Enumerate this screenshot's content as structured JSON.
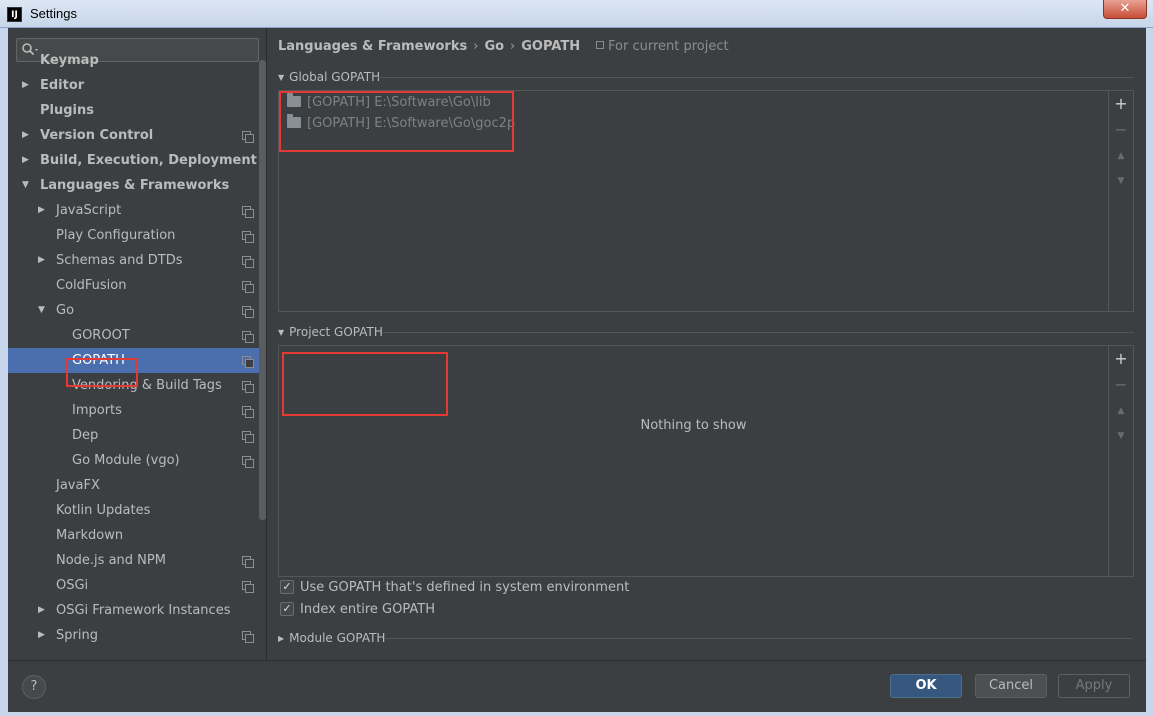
{
  "window": {
    "title": "Settings",
    "app_icon": "IJ",
    "close_glyph": "✕"
  },
  "sidebar": {
    "search_placeholder": "",
    "items": [
      {
        "label": "Keymap",
        "bold": true
      },
      {
        "label": "Editor",
        "bold": true
      },
      {
        "label": "Plugins",
        "bold": true
      },
      {
        "label": "Version Control",
        "bold": true
      },
      {
        "label": "Build, Execution, Deployment",
        "bold": true
      },
      {
        "label": "Languages & Frameworks",
        "bold": true
      },
      {
        "label": "JavaScript"
      },
      {
        "label": "Play Configuration"
      },
      {
        "label": "Schemas and DTDs"
      },
      {
        "label": "ColdFusion"
      },
      {
        "label": "Go"
      },
      {
        "label": "GOROOT"
      },
      {
        "label": "GOPATH"
      },
      {
        "label": "Vendoring & Build Tags"
      },
      {
        "label": "Imports"
      },
      {
        "label": "Dep"
      },
      {
        "label": "Go Module (vgo)"
      },
      {
        "label": "JavaFX"
      },
      {
        "label": "Kotlin Updates"
      },
      {
        "label": "Markdown"
      },
      {
        "label": "Node.js and NPM"
      },
      {
        "label": "OSGi"
      },
      {
        "label": "OSGi Framework Instances"
      },
      {
        "label": "Spring"
      }
    ]
  },
  "breadcrumb": {
    "part1": "Languages & Frameworks",
    "part2": "Go",
    "part3": "GOPATH",
    "separator": "›"
  },
  "scope_note": "For current project",
  "global_gopath": {
    "title": "Global GOPATH",
    "entries": [
      "[GOPATH] E:\\Software\\Go\\lib",
      "[GOPATH] E:\\Software\\Go\\goc2p"
    ]
  },
  "project_gopath": {
    "title": "Project GOPATH",
    "empty_text": "Nothing to show"
  },
  "toolbar": {
    "add": "+",
    "remove": "−",
    "up": "▲",
    "down": "▼"
  },
  "options": {
    "use_system_gopath": "Use GOPATH that's defined in system environment",
    "index_entire_gopath": "Index entire GOPATH"
  },
  "module_gopath": {
    "title": "Module GOPATH"
  },
  "footer": {
    "help": "?",
    "ok": "OK",
    "cancel": "Cancel",
    "apply": "Apply"
  }
}
